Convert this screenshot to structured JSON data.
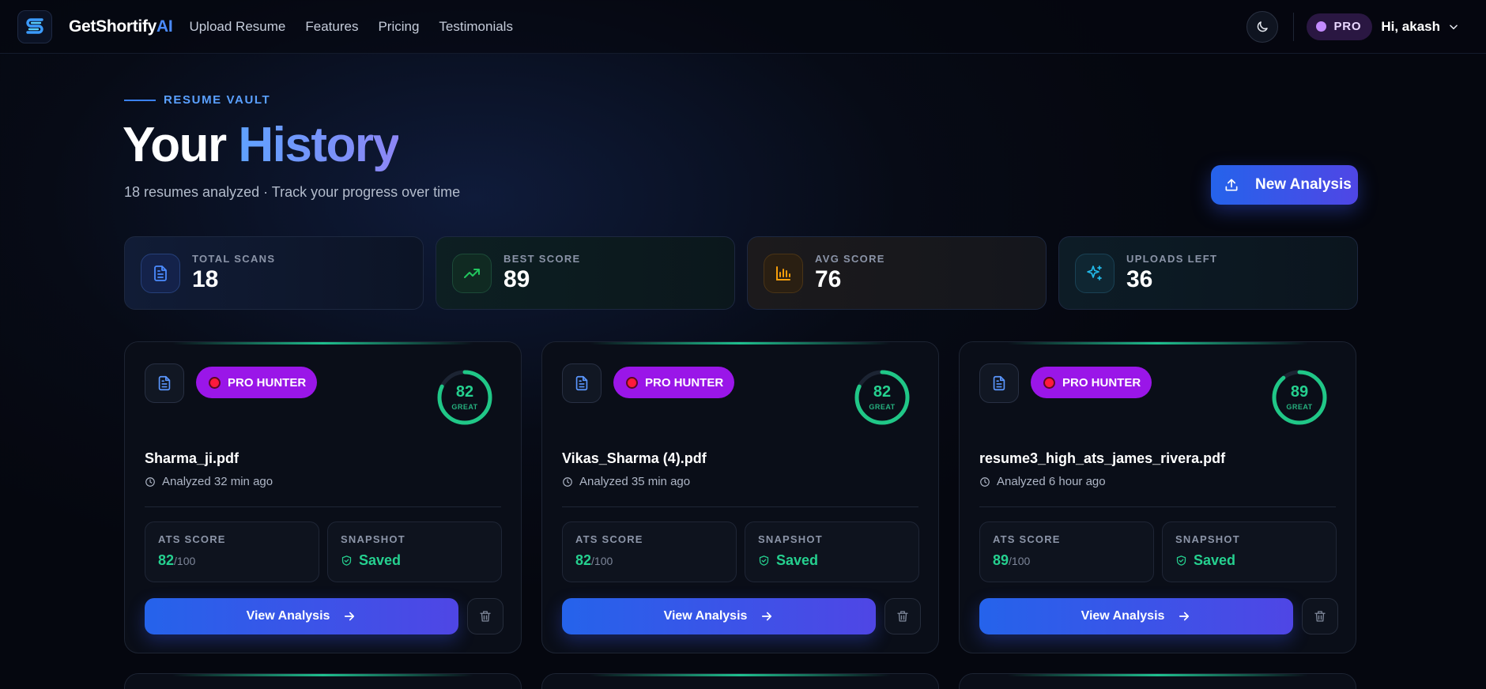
{
  "nav": {
    "brand_main": "GetShortify",
    "brand_ai": "AI",
    "links": [
      "Upload Resume",
      "Features",
      "Pricing",
      "Testimonials"
    ],
    "plan": "PRO",
    "greeting": "Hi, akash"
  },
  "hero": {
    "eyebrow": "RESUME VAULT",
    "title_main": "Your",
    "title_accent": "History",
    "subtitle": "18 resumes analyzed · Track your progress over time",
    "new_button": "New Analysis"
  },
  "stats": [
    {
      "label": "TOTAL SCANS",
      "value": "18",
      "icon": "document-icon",
      "color": "#4b8bff"
    },
    {
      "label": "BEST SCORE",
      "value": "89",
      "icon": "trending-up-icon",
      "color": "#22c55e"
    },
    {
      "label": "AVG SCORE",
      "value": "76",
      "icon": "bar-chart-icon",
      "color": "#f59e0b"
    },
    {
      "label": "UPLOADS LEFT",
      "value": "36",
      "icon": "sparkles-icon",
      "color": "#22b8e8"
    }
  ],
  "cards": [
    {
      "badge": "PRO HUNTER",
      "score": "82",
      "score_fraction": 0.82,
      "grade": "GREAT",
      "filename": "Sharma_ji.pdf",
      "analyzed": "Analyzed 32 min ago",
      "ats_label": "ATS SCORE",
      "ats_value": "82",
      "ats_den": "/100",
      "snapshot_label": "SNAPSHOT",
      "snapshot_value": "Saved",
      "view_label": "View Analysis"
    },
    {
      "badge": "PRO HUNTER",
      "score": "82",
      "score_fraction": 0.82,
      "grade": "GREAT",
      "filename": "Vikas_Sharma (4).pdf",
      "analyzed": "Analyzed 35 min ago",
      "ats_label": "ATS SCORE",
      "ats_value": "82",
      "ats_den": "/100",
      "snapshot_label": "SNAPSHOT",
      "snapshot_value": "Saved",
      "view_label": "View Analysis"
    },
    {
      "badge": "PRO HUNTER",
      "score": "89",
      "score_fraction": 0.89,
      "grade": "GREAT",
      "filename": "resume3_high_ats_james_rivera.pdf",
      "analyzed": "Analyzed 6 hour ago",
      "ats_label": "ATS SCORE",
      "ats_value": "89",
      "ats_den": "/100",
      "snapshot_label": "SNAPSHOT",
      "snapshot_value": "Saved",
      "view_label": "View Analysis"
    }
  ],
  "colors": {
    "accent": "#2563eb",
    "score_green": "#25d08f",
    "badge_purple": "#9a16e8"
  }
}
